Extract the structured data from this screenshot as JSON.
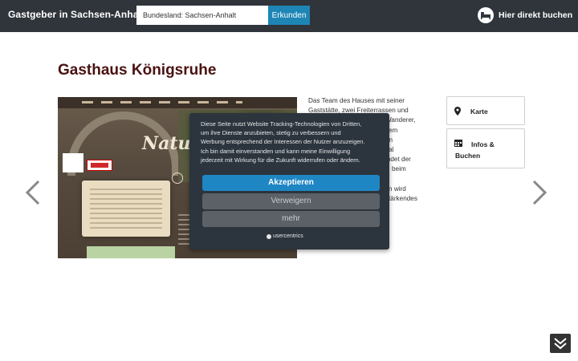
{
  "header": {
    "brand": "Gastgeber in Sachsen-Anhalt",
    "search_value": "Bundesland: Sachsen-Anhalt",
    "search_button": "Erkunden",
    "direct_book": "Hier direkt buchen",
    "direct_book_icon": "bed-icon"
  },
  "main": {
    "title": "Gasthaus Königsruhe",
    "photo_heading": "Natur",
    "description_lines": [
      "Das Team des Hauses mit seiner",
      "Gaststätte, zwei Freiterrassen und",
      "Wanderer,",
      "em",
      "en",
      "Tal",
      "indet der",
      "beim",
      "",
      "n wird",
      "tärkendes"
    ]
  },
  "sidebar": {
    "karte": "Karte",
    "karte_icon": "map-marker-icon",
    "infos": "Infos & Buchen",
    "infos_icon": "calendar-icon"
  },
  "consent": {
    "lines": [
      "Diese Seite nutzt Website Tracking-Technologien von Dritten,",
      "um ihre Dienste anzubieten, stetig zu verbessern und",
      "Werbung entsprechend der Interessen der Nutzer anzuzeigen.",
      "Ich bin damit einverstanden und kann meine Einwilligung",
      "jederzeit mit Wirkung für die Zukunft widerrufen oder ändern."
    ],
    "accept": "Akzeptieren",
    "deny": "Verweigern",
    "more": "mehr",
    "brand": "usercentrics"
  },
  "colors": {
    "header_bg": "#2f353b",
    "accent": "#1e86b5",
    "title": "#4a1212"
  }
}
